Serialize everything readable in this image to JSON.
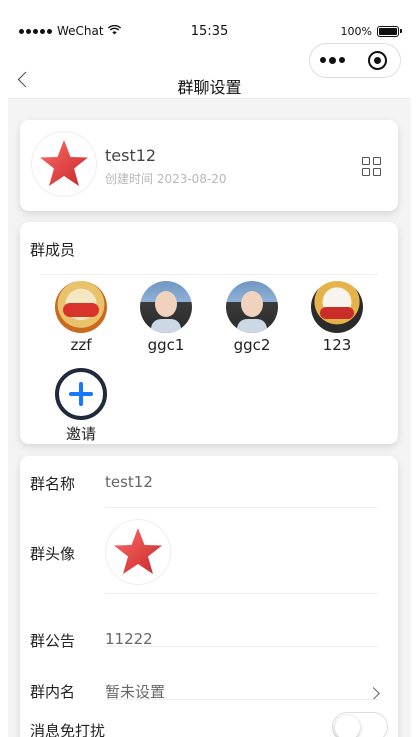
{
  "status_bar": {
    "carrier": "WeChat",
    "time": "15:35",
    "battery": "100%"
  },
  "nav": {
    "title": "群聊设置"
  },
  "group": {
    "name": "test12",
    "created": "创建时间 2023-08-20"
  },
  "members_section": {
    "title": "群成员",
    "members": [
      {
        "name": "zzf"
      },
      {
        "name": "ggc1"
      },
      {
        "name": "ggc2"
      },
      {
        "name": "123"
      }
    ],
    "invite_label": "邀请"
  },
  "settings": {
    "group_name_label": "群名称",
    "group_name_value": "test12",
    "group_avatar_label": "群头像",
    "announcement_label": "群公告",
    "announcement_value": "11222",
    "nickname_label": "群内名",
    "nickname_value": "暂未设置",
    "dnd_label": "消息免打扰",
    "dnd_on": false
  },
  "colors": {
    "accent": "#1677ff",
    "page_bg": "#f4f4f4",
    "star": "#e53935"
  }
}
